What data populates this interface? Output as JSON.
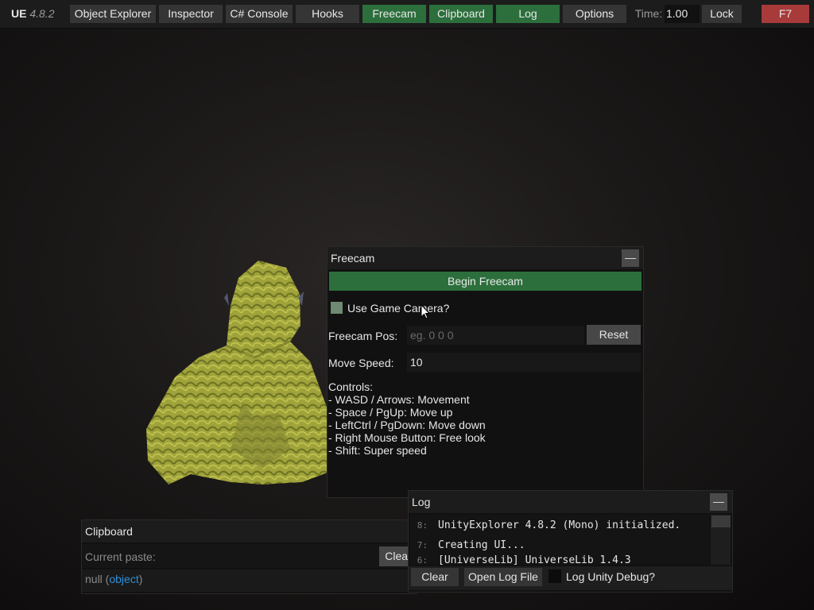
{
  "topbar": {
    "app_name": "UE",
    "version": "4.8.2",
    "buttons": {
      "object_explorer": "Object Explorer",
      "inspector": "Inspector",
      "csharp_console": "C# Console",
      "hooks": "Hooks",
      "freecam": "Freecam",
      "clipboard": "Clipboard",
      "log": "Log",
      "options": "Options"
    },
    "time_label": "Time:",
    "time_value": "1.00",
    "lock_label": "Lock",
    "hotkey_label": "F7",
    "colors": {
      "active": "#2c6f3c",
      "inactive": "#353535",
      "hotkey": "#a83a3a"
    }
  },
  "freecam": {
    "title": "Freecam",
    "minimize": "—",
    "begin_label": "Begin Freecam",
    "use_game_camera_label": "Use Game Camera?",
    "pos_label": "Freecam Pos:",
    "pos_placeholder": "eg. 0 0 0",
    "reset_label": "Reset",
    "speed_label": "Move Speed:",
    "speed_value": "10",
    "controls": [
      "Controls:",
      "- WASD / Arrows: Movement",
      "- Space / PgUp: Move up",
      "- LeftCtrl / PgDown: Move down",
      "- Right Mouse Button: Free look",
      "- Shift: Super speed"
    ]
  },
  "clipboard": {
    "title": "Clipboard",
    "current_paste_label": "Current paste:",
    "clear_label": "Clear",
    "value_null": "null",
    "value_type": "object"
  },
  "log": {
    "title": "Log",
    "minimize": "—",
    "lines": [
      {
        "num": "8:",
        "text": "UnityExplorer 4.8.2 (Mono) initialized."
      },
      {
        "num": "7:",
        "text": "Creating UI..."
      },
      {
        "num": "6:",
        "text": "[UniverseLib] UniverseLib 1.4.3"
      }
    ],
    "clear_label": "Clear",
    "open_file_label": "Open Log File",
    "unity_debug_label": "Log Unity Debug?"
  }
}
